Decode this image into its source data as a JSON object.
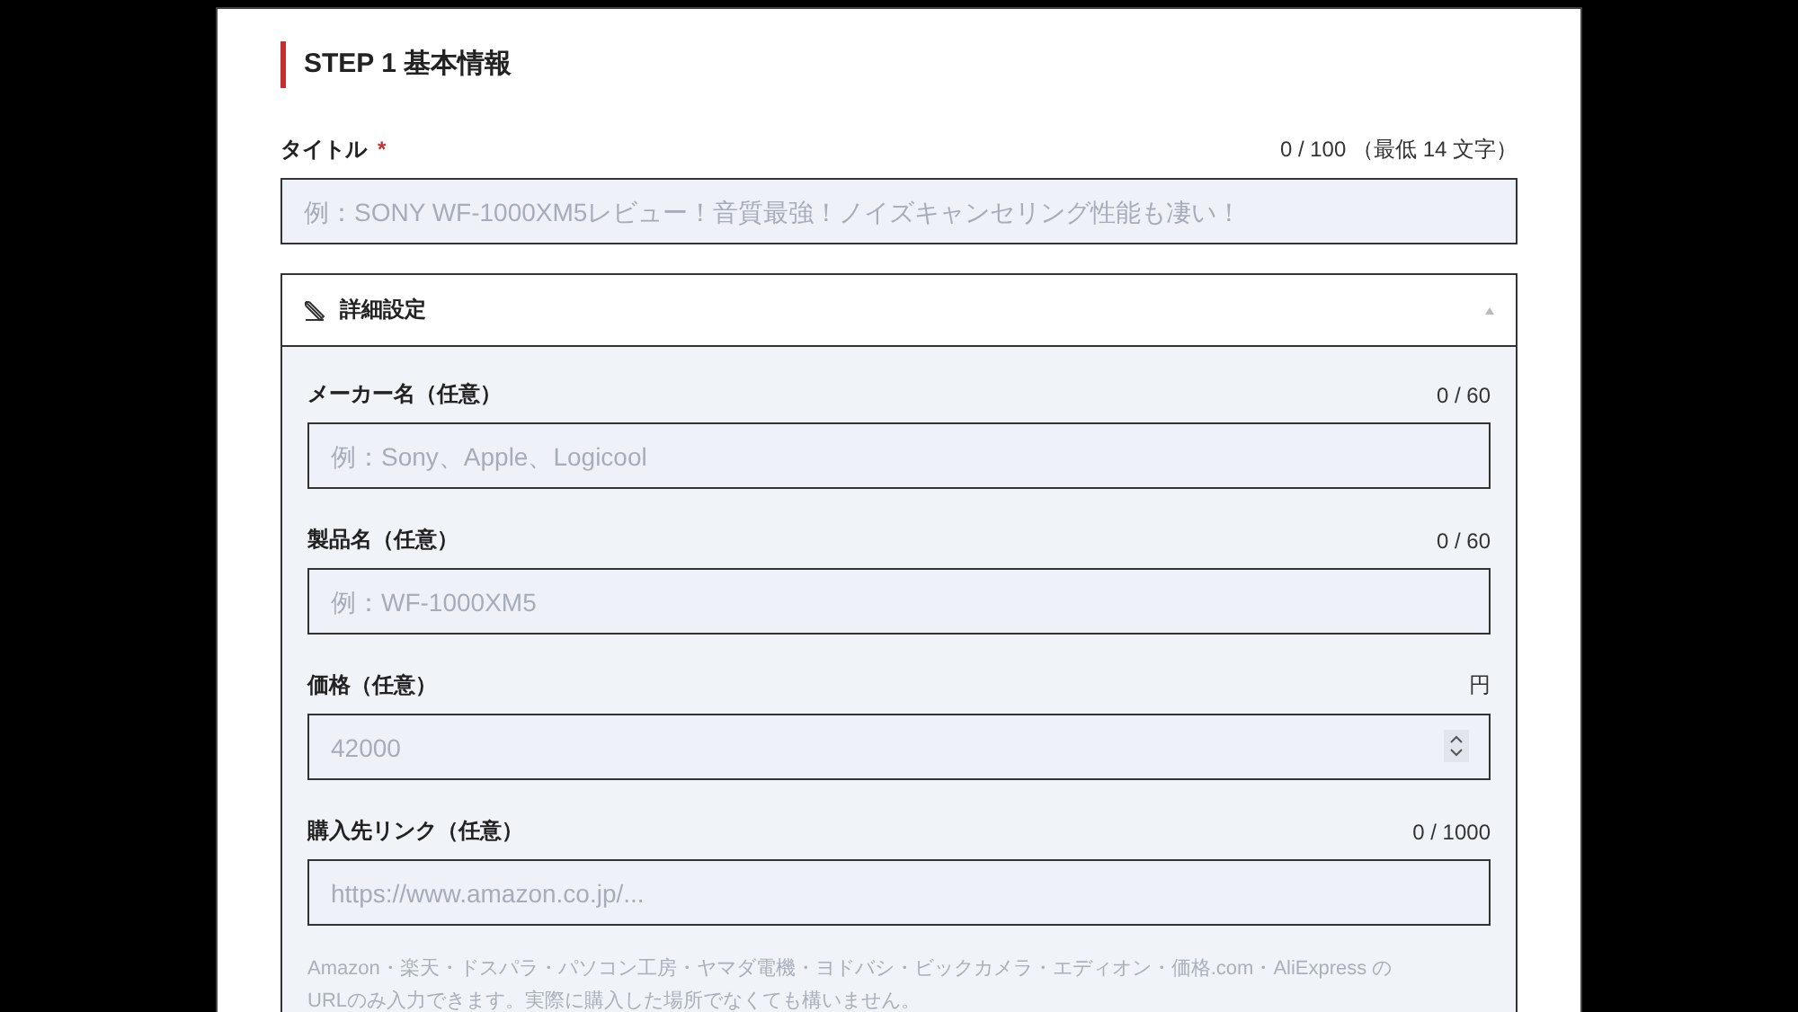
{
  "section": {
    "step": "STEP 1",
    "title": "基本情報"
  },
  "title_field": {
    "label": "タイトル",
    "required": true,
    "required_mark": "*",
    "counter": "0 / 100 （最低 14 文字）",
    "placeholder": "例：SONY WF-1000XM5レビュー！音質最強！ノイズキャンセリング性能も凄い！"
  },
  "details": {
    "label": "詳細設定",
    "expanded": true,
    "fields": [
      {
        "kind": "text",
        "label": "メーカー名（任意）",
        "counter": "0 / 60",
        "placeholder": "例：Sony、Apple、Logicool"
      },
      {
        "kind": "text",
        "label": "製品名（任意）",
        "counter": "0 / 60",
        "placeholder": "例：WF-1000XM5"
      },
      {
        "kind": "number",
        "label": "価格（任意）",
        "counter": "円",
        "placeholder": "42000"
      },
      {
        "kind": "text",
        "label": "購入先リンク（任意）",
        "counter": "0 / 1000",
        "placeholder": "https://www.amazon.co.jp/..."
      }
    ],
    "hint": "Amazon・楽天・ドスパラ・パソコン工房・ヤマダ電機・ヨドバシ・ビックカメラ・エディオン・価格.com・AliExpress の URLのみ入力できます。実際に購入した場所でなくても構いません。"
  }
}
